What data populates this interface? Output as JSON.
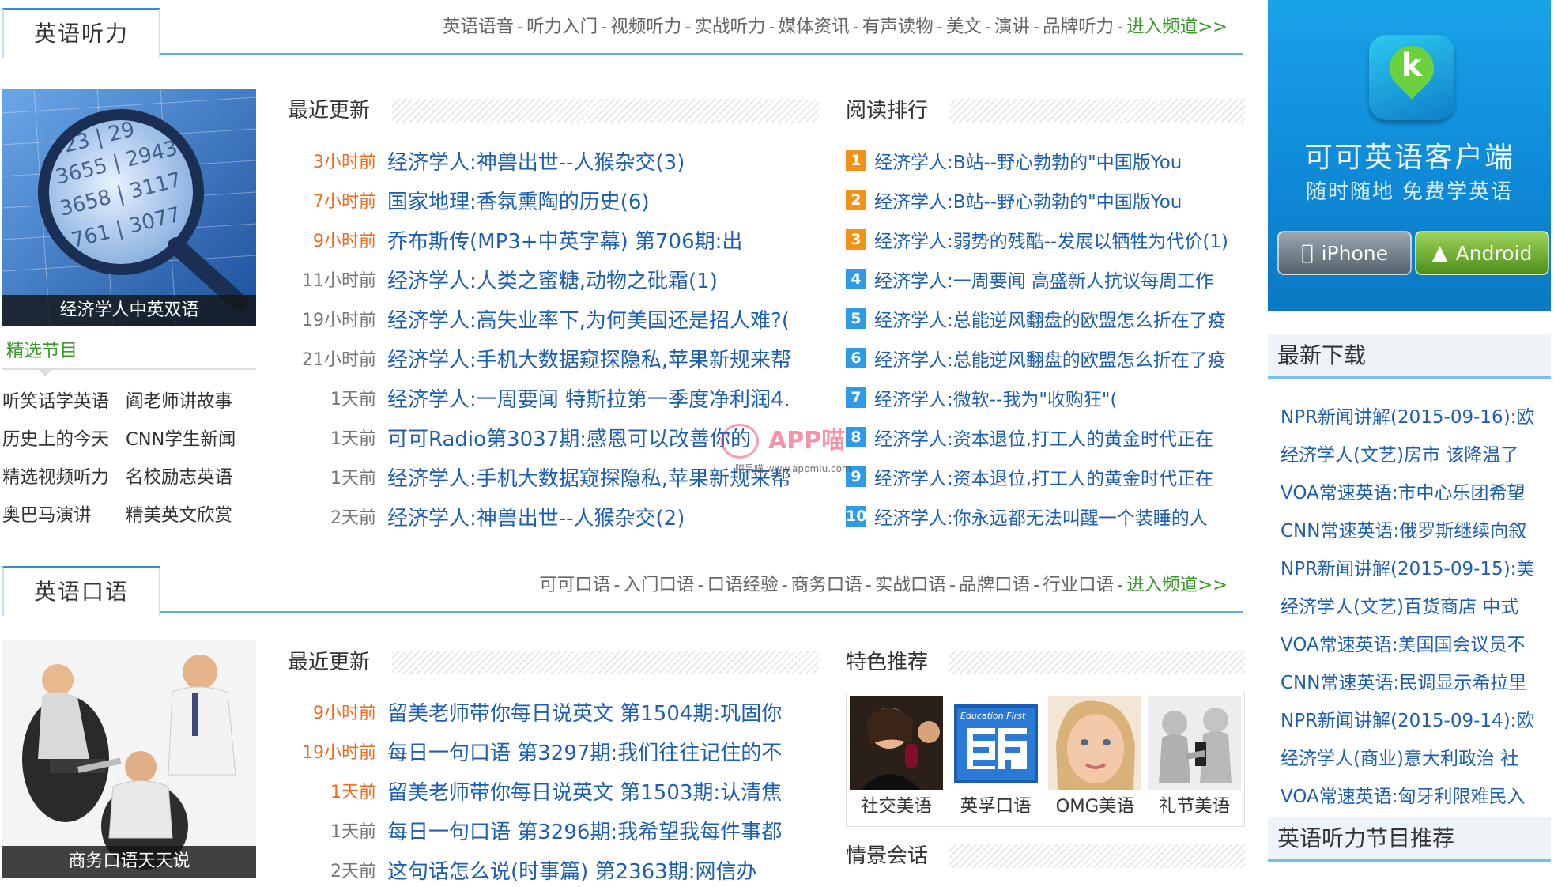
{
  "colors": {
    "accent_blue": "#2f8fd6",
    "link_blue": "#1f5fb0",
    "time_orange": "#ef6b1f",
    "green": "#3a9a2a",
    "rank_top": "#f39217",
    "rank_rest": "#2d9be8"
  },
  "listening": {
    "tab": "英语听力",
    "nav": [
      "英语语音",
      "听力入门",
      "视频听力",
      "实战听力",
      "媒体资讯",
      "有声读物",
      "美文",
      "演讲",
      "品牌听力"
    ],
    "enter": "进入频道>>",
    "feature_caption": "经济学人中英双语",
    "picks_title": "精选节目",
    "picks": [
      "听笑话学英语",
      "阎老师讲故事",
      "历史上的今天",
      "CNN学生新闻",
      "精选视频听力",
      "名校励志英语",
      "奥巴马演讲",
      "精美英文欣赏"
    ],
    "recent_title": "最近更新",
    "recent": [
      {
        "time": "3小时前",
        "hot": true,
        "title": "经济学人:神兽出世--人猴杂交(3)"
      },
      {
        "time": "7小时前",
        "hot": true,
        "title": "国家地理:香氛熏陶的历史(6)"
      },
      {
        "time": "9小时前",
        "hot": true,
        "title": "乔布斯传(MP3+中英字幕) 第706期:出"
      },
      {
        "time": "11小时前",
        "hot": false,
        "title": "经济学人:人类之蜜糖,动物之砒霜(1)"
      },
      {
        "time": "19小时前",
        "hot": false,
        "title": "经济学人:高失业率下,为何美国还是招人难?("
      },
      {
        "time": "21小时前",
        "hot": false,
        "title": "经济学人:手机大数据窥探隐私,苹果新规来帮"
      },
      {
        "time": "1天前",
        "hot": false,
        "title": "经济学人:一周要闻 特斯拉第一季度净利润4."
      },
      {
        "time": "1天前",
        "hot": false,
        "title": "可可Radio第3037期:感恩可以改善你的"
      },
      {
        "time": "1天前",
        "hot": false,
        "title": "经济学人:手机大数据窥探隐私,苹果新规来帮"
      },
      {
        "time": "2天前",
        "hot": false,
        "title": "经济学人:神兽出世--人猴杂交(2)"
      }
    ],
    "rank_title": "阅读排行",
    "rank": [
      {
        "num": "1",
        "title": "经济学人:B站--野心勃勃的\"中国版You"
      },
      {
        "num": "2",
        "title": "经济学人:B站--野心勃勃的\"中国版You"
      },
      {
        "num": "3",
        "title": "经济学人:弱势的残酷--发展以牺牲为代价(1)"
      },
      {
        "num": "4",
        "title": "经济学人:一周要闻 高盛新人抗议每周工作"
      },
      {
        "num": "5",
        "title": "经济学人:总能逆风翻盘的欧盟怎么折在了疫"
      },
      {
        "num": "6",
        "title": "经济学人:总能逆风翻盘的欧盟怎么折在了疫"
      },
      {
        "num": "7",
        "title": "经济学人:微软--我为\"收购狂\"("
      },
      {
        "num": "8",
        "title": "经济学人:资本退位,打工人的黄金时代正在"
      },
      {
        "num": "9",
        "title": "经济学人:资本退位,打工人的黄金时代正在"
      },
      {
        "num": "10",
        "title": "经济学人:你永远都无法叫醒一个装睡的人"
      }
    ]
  },
  "speaking": {
    "tab": "英语口语",
    "nav": [
      "可可口语",
      "入门口语",
      "口语经验",
      "商务口语",
      "实战口语",
      "品牌口语",
      "行业口语"
    ],
    "enter": "进入频道>>",
    "feature_caption": "商务口语天天说",
    "recent_title": "最近更新",
    "recent": [
      {
        "time": "9小时前",
        "hot": true,
        "title": "留美老师带你每日说英文 第1504期:巩固你"
      },
      {
        "time": "19小时前",
        "hot": true,
        "title": "每日一句口语 第3297期:我们往往记住的不"
      },
      {
        "time": "1天前",
        "hot": true,
        "title": "留美老师带你每日说英文 第1503期:认清焦"
      },
      {
        "time": "1天前",
        "hot": false,
        "title": "每日一句口语 第3296期:我希望我每件事都"
      },
      {
        "time": "2天前",
        "hot": false,
        "title": "这句话怎么说(时事篇) 第2363期:网信办"
      }
    ],
    "featured_title": "特色推荐",
    "featured": [
      {
        "label": "社交美语",
        "icon": "social-english-image"
      },
      {
        "label": "英孚口语",
        "icon": "ef-logo-image"
      },
      {
        "label": "OMG美语",
        "icon": "omg-english-image"
      },
      {
        "label": "礼节美语",
        "icon": "etiquette-english-image"
      }
    ],
    "scene_title": "情景会话"
  },
  "sidebar": {
    "app_title": "可可英语客户端",
    "app_sub": "随时随地  免费学英语",
    "app_logo_letter": "k",
    "iphone_label": "iPhone",
    "android_label": "Android",
    "downloads_title": "最新下载",
    "downloads": [
      "NPR新闻讲解(2015-09-16):欧",
      "经济学人(文艺)房市 该降温了",
      "VOA常速英语:市中心乐团希望",
      "CNN常速英语:俄罗斯继续向叙",
      "NPR新闻讲解(2015-09-15):美",
      "经济学人(文艺)百货商店 中式",
      "VOA常速英语:美国国会议员不",
      "CNN常速英语:民调显示希拉里",
      "NPR新闻讲解(2015-09-14):欧",
      "经济学人(商业)意大利政治 社",
      "VOA常速英语:匈牙利限难民入"
    ],
    "recommend_title": "英语听力节目推荐"
  },
  "watermark": {
    "text": "APP喵",
    "url": "阿呆喵 www.appmiu.com"
  }
}
